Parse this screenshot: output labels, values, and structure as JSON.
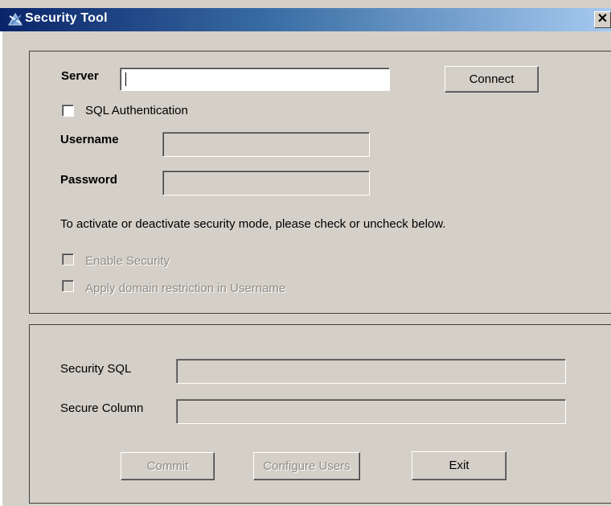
{
  "window": {
    "title": "Security Tool",
    "close_glyph": "✕",
    "title_icon": "security-tool-app-icon"
  },
  "connection": {
    "server_label": "Server",
    "server_value": "",
    "connect_label": "Connect",
    "sql_auth_label": "SQL Authentication",
    "sql_auth_checked": false,
    "username_label": "Username",
    "username_value": "",
    "password_label": "Password",
    "password_value": "",
    "instructions": "To activate or deactivate security mode, please check or uncheck below.",
    "enable_security_label": "Enable Security",
    "enable_security_checked": false,
    "domain_restriction_label": "Apply domain restriction in Username",
    "domain_restriction_checked": false
  },
  "security": {
    "security_sql_label": "Security SQL",
    "security_sql_value": "",
    "secure_column_label": "Secure Column",
    "secure_column_value": "",
    "commit_label": "Commit",
    "configure_users_label": "Configure Users",
    "exit_label": "Exit"
  },
  "colors": {
    "dialog_bg": "#d4d0c8",
    "title_start": "#0a246a",
    "title_end": "#a6caf0",
    "disabled_text": "#8e8c86"
  }
}
